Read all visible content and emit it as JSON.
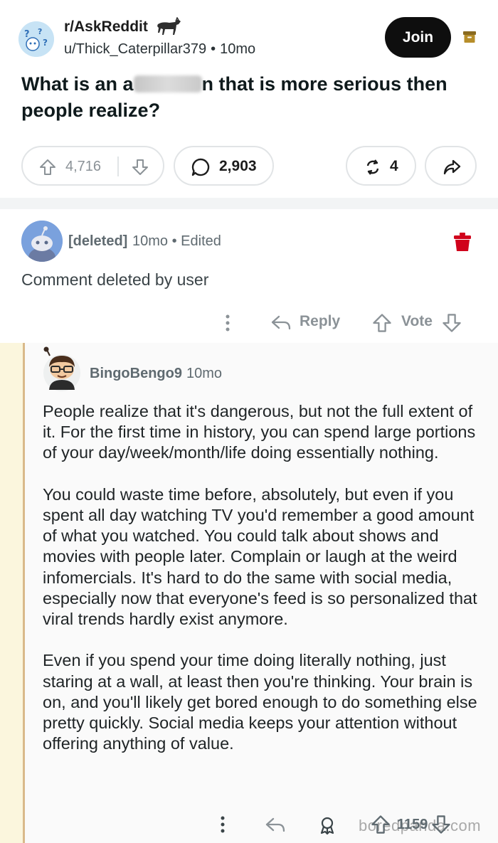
{
  "post": {
    "subreddit": "r/AskReddit",
    "author": "u/Thick_Caterpillar379",
    "separator": "•",
    "age": "10mo",
    "join_label": "Join",
    "title_before": "What is an a",
    "title_after": "n that is more serious then people realize?",
    "upvotes": "4,716",
    "comments": "2,903",
    "awards": "4"
  },
  "deleted_comment": {
    "author": "[deleted]",
    "age": "10mo",
    "separator": "•",
    "edited": "Edited",
    "body": "Comment deleted by user",
    "reply_label": "Reply",
    "vote_label": "Vote"
  },
  "reply_comment": {
    "author": "BingoBengo9",
    "age": "10mo",
    "paragraphs": [
      "People realize that it's dangerous, but not the full extent of it. For the first time in history, you can spend large portions of your day/week/month/life doing essentially nothing.",
      "You could waste time before, absolutely, but even if you spent all day watching TV you'd remember a good amount of what you watched. You could talk about shows and movies with people later. Complain or laugh at the weird infomercials. It's hard to do the same with social media, especially now that everyone's feed is so personalized that viral trends hardly exist anymore.",
      "Even if you spend your time doing literally nothing, just staring at a wall, at least then you're thinking. Your brain is on, and you'll likely get bored enough to do something else pretty quickly. Social media keeps your attention without offering anything of value."
    ],
    "score": "1159",
    "watermark": "boredpanda.com"
  },
  "icons": [
    "subreddit-avatar",
    "horse-flair",
    "archive-icon",
    "upvote-icon",
    "downvote-icon",
    "comment-icon",
    "award-icon",
    "share-icon",
    "trash-icon",
    "more-icon",
    "reply-icon"
  ],
  "colors": {
    "join_bg": "#0e0e0e",
    "trash": "#d0021b",
    "thread_line": "#d9b98a",
    "archive": "#8a6a1f"
  }
}
